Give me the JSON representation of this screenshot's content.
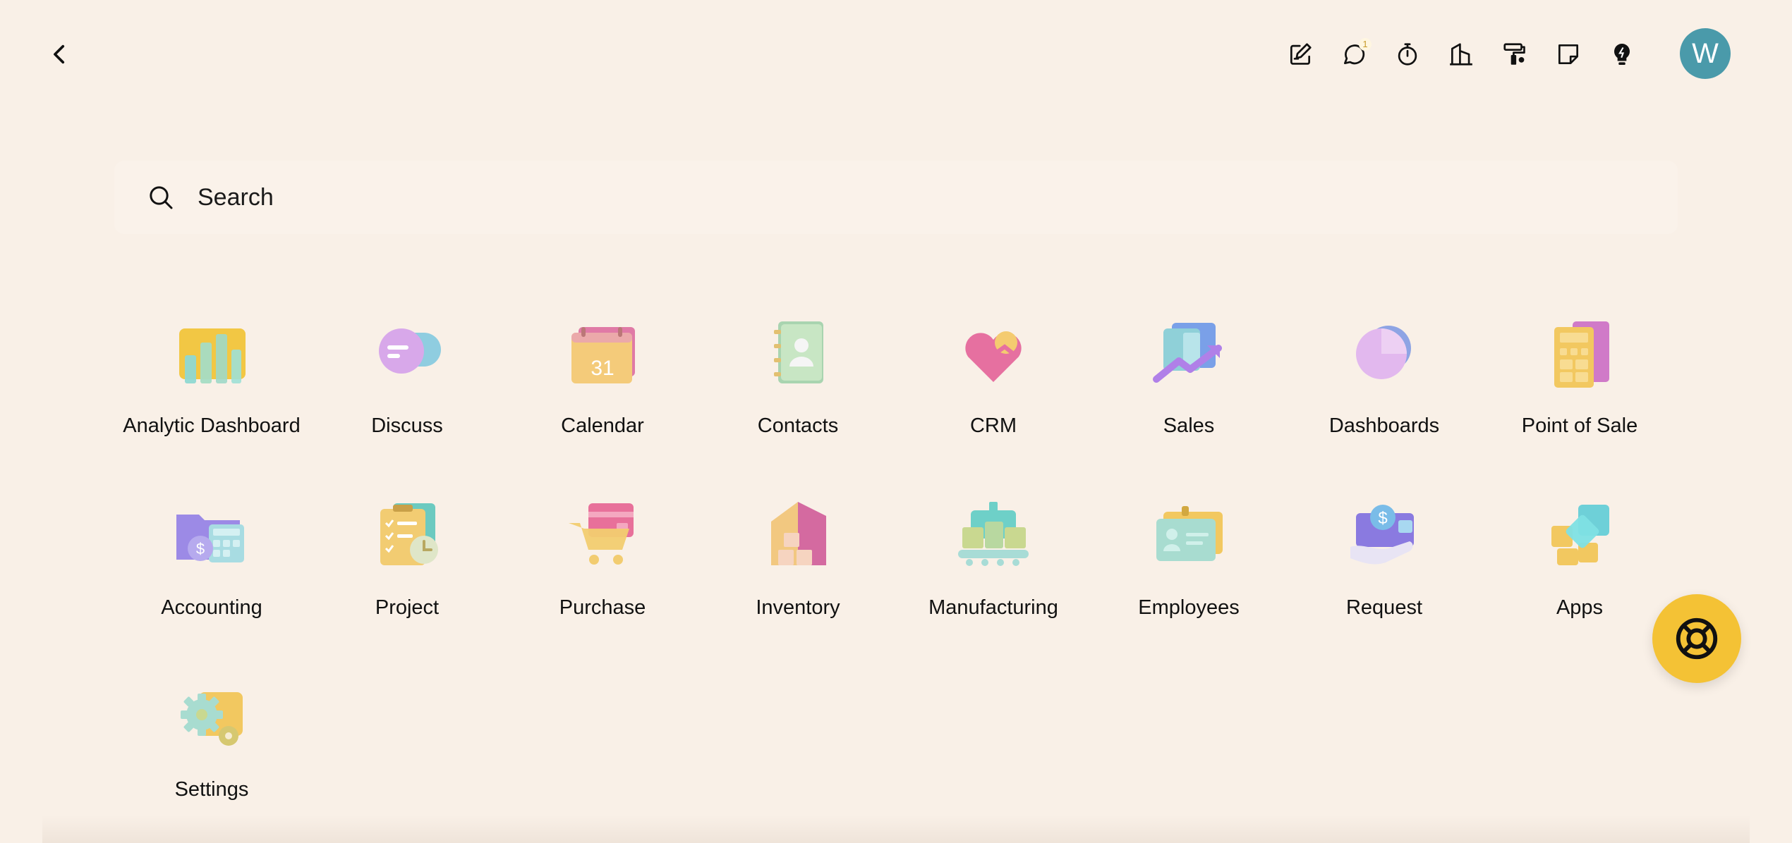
{
  "header": {
    "back_icon": "chevron-left-icon",
    "tools": [
      {
        "name": "edit-note-icon"
      },
      {
        "name": "chat-bubble-icon",
        "badge": "1"
      },
      {
        "name": "stopwatch-icon"
      },
      {
        "name": "building-icon"
      },
      {
        "name": "paint-roller-icon"
      },
      {
        "name": "sticky-note-icon"
      },
      {
        "name": "lightbulb-icon"
      }
    ],
    "avatar_letter": "W",
    "avatar_color": "#4a9aaa"
  },
  "search": {
    "placeholder": "Search"
  },
  "apps": [
    {
      "label": "Analytic Dashboard",
      "icon": "analytic-dashboard-icon"
    },
    {
      "label": "Discuss",
      "icon": "discuss-icon"
    },
    {
      "label": "Calendar",
      "icon": "calendar-icon",
      "icon_text": "31"
    },
    {
      "label": "Contacts",
      "icon": "contacts-icon"
    },
    {
      "label": "CRM",
      "icon": "crm-icon"
    },
    {
      "label": "Sales",
      "icon": "sales-icon"
    },
    {
      "label": "Dashboards",
      "icon": "dashboards-icon"
    },
    {
      "label": "Point of Sale",
      "icon": "point-of-sale-icon"
    },
    {
      "label": "Accounting",
      "icon": "accounting-icon"
    },
    {
      "label": "Project",
      "icon": "project-icon"
    },
    {
      "label": "Purchase",
      "icon": "purchase-icon"
    },
    {
      "label": "Inventory",
      "icon": "inventory-icon"
    },
    {
      "label": "Manufacturing",
      "icon": "manufacturing-icon"
    },
    {
      "label": "Employees",
      "icon": "employees-icon"
    },
    {
      "label": "Request",
      "icon": "request-icon"
    },
    {
      "label": "Apps",
      "icon": "apps-icon"
    },
    {
      "label": "Settings",
      "icon": "settings-icon"
    }
  ],
  "support_button_icon": "lifebuoy-icon",
  "colors": {
    "background": "#f9f0e7",
    "support_button": "#f4c235"
  }
}
